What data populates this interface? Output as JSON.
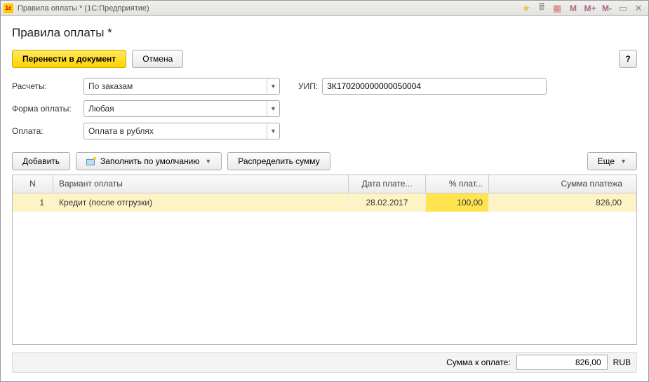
{
  "titlebar": {
    "title": "Правила оплаты * (1С:Предприятие)"
  },
  "header": {
    "title": "Правила оплаты *"
  },
  "buttons": {
    "submit": "Перенести в документ",
    "cancel": "Отмена",
    "help": "?",
    "add": "Добавить",
    "fill_default": "Заполнить по умолчанию",
    "distribute": "Распределить сумму",
    "more": "Еще"
  },
  "form": {
    "raschety_label": "Расчеты:",
    "raschety_value": "По заказам",
    "uip_label": "УИП:",
    "uip_value": "3К170200000000050004",
    "forma_label": "Форма оплаты:",
    "forma_value": "Любая",
    "oplata_label": "Оплата:",
    "oplata_value": "Оплата в рублях"
  },
  "table": {
    "headers": {
      "n": "N",
      "variant": "Вариант оплаты",
      "date": "Дата плате...",
      "pct": "% плат...",
      "sum": "Сумма платежа"
    },
    "rows": [
      {
        "n": "1",
        "variant": "Кредит (после отгрузки)",
        "date": "28.02.2017",
        "pct": "100,00",
        "sum": "826,00"
      }
    ]
  },
  "footer": {
    "label": "Сумма к оплате:",
    "value": "826,00",
    "currency": "RUB"
  }
}
